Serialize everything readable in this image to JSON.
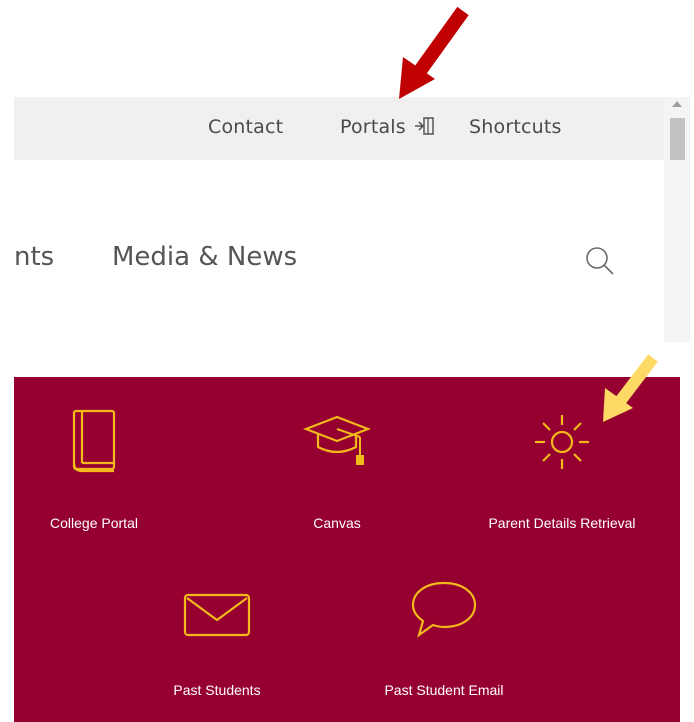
{
  "topbar": {
    "contact": "Contact",
    "portals": "Portals",
    "shortcuts": "Shortcuts"
  },
  "nav": {
    "partial_item": "nts",
    "media_news": "Media & News"
  },
  "portals_panel": {
    "items": [
      {
        "label": "College Portal",
        "icon": "book-icon"
      },
      {
        "label": "Canvas",
        "icon": "graduation-cap-icon"
      },
      {
        "label": "Parent Details Retrieval",
        "icon": "sun-icon"
      },
      {
        "label": "Past Students",
        "icon": "envelope-icon"
      },
      {
        "label": "Past Student Email",
        "icon": "speech-bubble-icon"
      }
    ]
  },
  "colors": {
    "panel_bg": "#960031",
    "icon_gold": "#f2b91a",
    "annotation_red": "#c00000",
    "annotation_yellow": "#ffd966"
  }
}
